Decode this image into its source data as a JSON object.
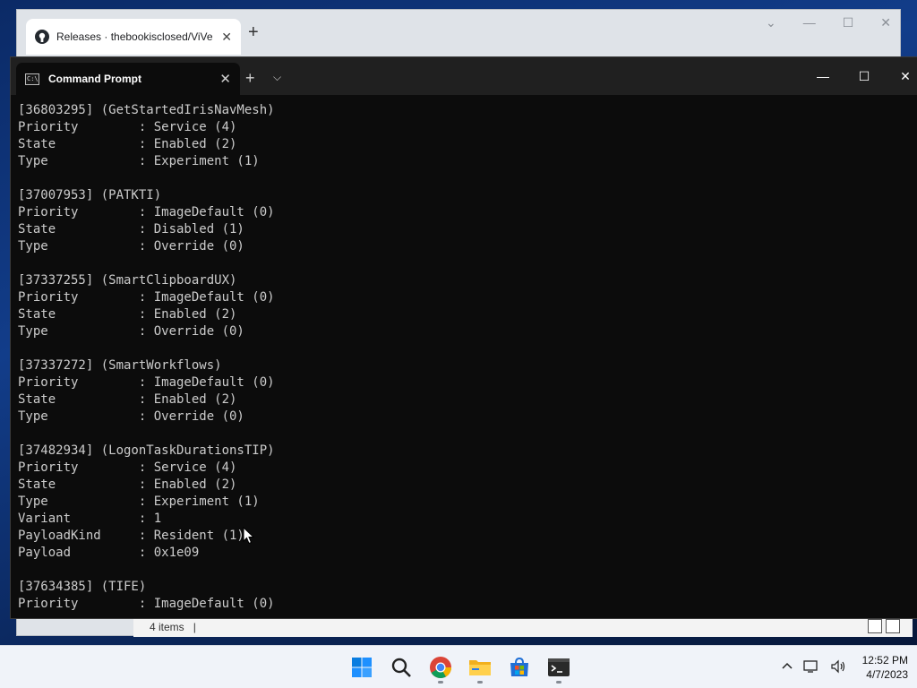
{
  "browser": {
    "tab_title": "Releases · thebookisclosed/ViVe",
    "new_tab": "+",
    "status_items": "4 items",
    "status_sep": "|"
  },
  "terminal": {
    "tab_title": "Command Prompt",
    "new_tab": "+",
    "lines": [
      "[36803295] (GetStartedIrisNavMesh)",
      "Priority        : Service (4)",
      "State           : Enabled (2)",
      "Type            : Experiment (1)",
      "",
      "[37007953] (PATKTI)",
      "Priority        : ImageDefault (0)",
      "State           : Disabled (1)",
      "Type            : Override (0)",
      "",
      "[37337255] (SmartClipboardUX)",
      "Priority        : ImageDefault (0)",
      "State           : Enabled (2)",
      "Type            : Override (0)",
      "",
      "[37337272] (SmartWorkflows)",
      "Priority        : ImageDefault (0)",
      "State           : Enabled (2)",
      "Type            : Override (0)",
      "",
      "[37482934] (LogonTaskDurationsTIP)",
      "Priority        : Service (4)",
      "State           : Enabled (2)",
      "Type            : Experiment (1)",
      "Variant         : 1",
      "PayloadKind     : Resident (1)",
      "Payload         : 0x1e09",
      "",
      "[37634385] (TIFE)",
      "Priority        : ImageDefault (0)"
    ]
  },
  "taskbar": {
    "apps": [
      "start-icon",
      "search-icon",
      "chrome-icon",
      "file-explorer-icon",
      "microsoft-store-icon",
      "terminal-icon"
    ],
    "time": "12:52 PM",
    "date": "4/7/2023"
  }
}
